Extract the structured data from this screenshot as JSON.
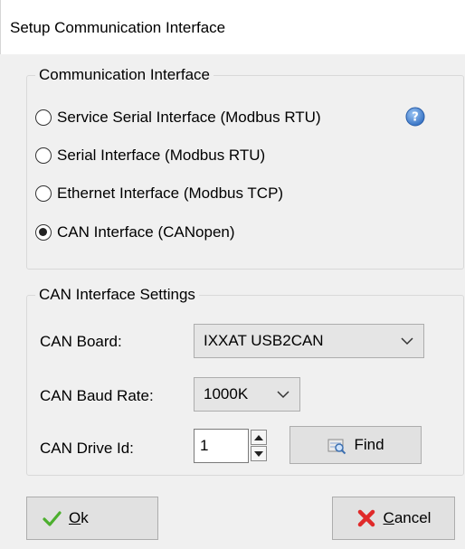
{
  "window": {
    "title": "Setup Communication Interface"
  },
  "comm_group": {
    "legend": "Communication Interface",
    "options": [
      {
        "label": "Service Serial Interface (Modbus RTU)",
        "selected": false
      },
      {
        "label": "Serial Interface (Modbus RTU)",
        "selected": false
      },
      {
        "label": "Ethernet Interface (Modbus TCP)",
        "selected": false
      },
      {
        "label": "CAN Interface (CANopen)",
        "selected": true
      }
    ],
    "help_icon": "help-icon"
  },
  "can_group": {
    "legend": "CAN Interface Settings",
    "board_label": "CAN Board:",
    "board_value": "IXXAT USB2CAN",
    "baud_label": "CAN Baud Rate:",
    "baud_value": "1000K",
    "drive_label": "CAN Drive Id:",
    "drive_value": "1",
    "find_label": "Find"
  },
  "footer": {
    "ok_mnemonic": "O",
    "ok_rest": "k",
    "cancel_mnemonic": "C",
    "cancel_rest": "ancel"
  },
  "colors": {
    "dialog_bg": "#f0f0f0",
    "help_blue": "#3a78c9",
    "ok_green": "#4caf2e",
    "cancel_red": "#e02a2a"
  }
}
